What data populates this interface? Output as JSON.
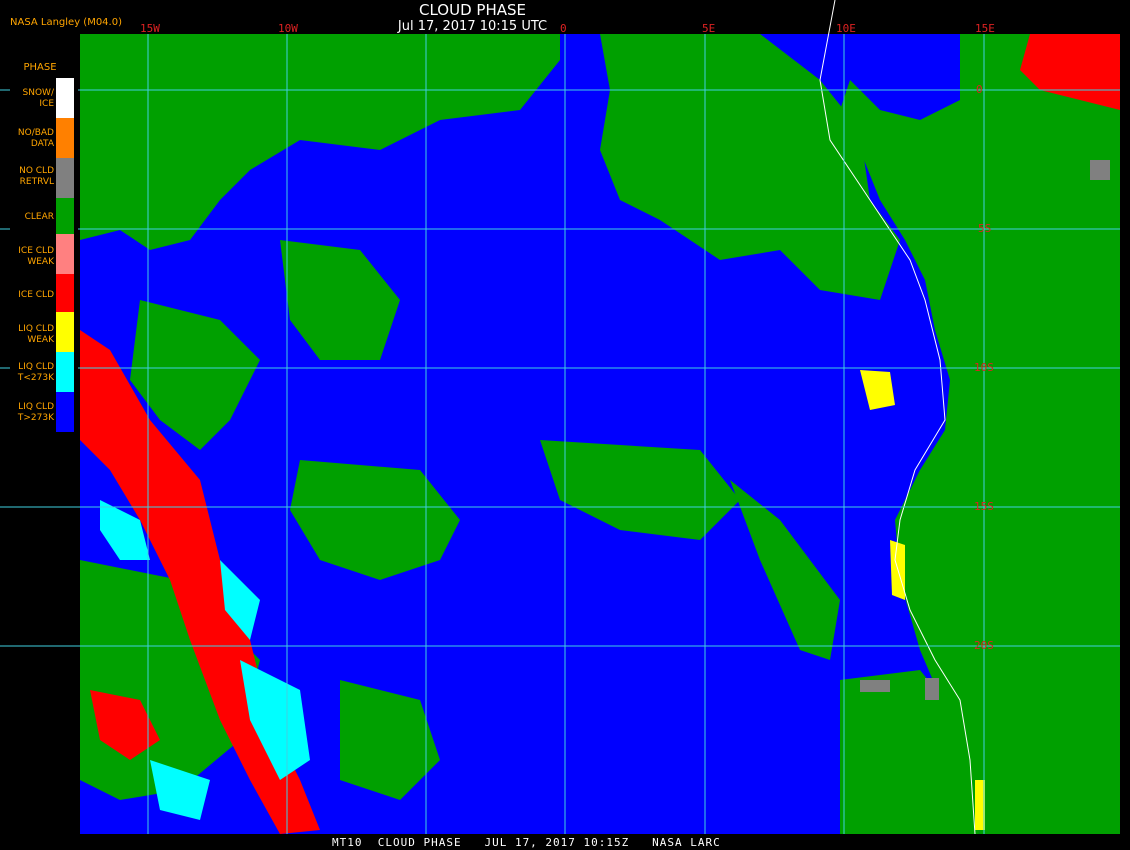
{
  "header": {
    "title": "CLOUD PHASE",
    "date": "Jul 17, 2017 10:15 UTC",
    "credit": "NASA Langley (M04.0)"
  },
  "legend": {
    "title": "PHASE",
    "items": [
      {
        "label": "SNOW/\nICE",
        "color": "#ffffff"
      },
      {
        "label": "NO/BAD\nDATA",
        "color": "#ff8000"
      },
      {
        "label": "NO CLD\nRETRVL",
        "color": "#808080"
      },
      {
        "label": "CLEAR",
        "color": "#00a000"
      },
      {
        "label": "ICE CLD\nWEAK",
        "color": "#ff8080"
      },
      {
        "label": "ICE CLD",
        "color": "#ff0000"
      },
      {
        "label": "LIQ CLD\nWEAK",
        "color": "#ffff00"
      },
      {
        "label": "LIQ CLD\nT<273K",
        "color": "#00ffff"
      },
      {
        "label": "LIQ CLD\nT>273K",
        "color": "#0000ff"
      }
    ]
  },
  "grid": {
    "lon_labels": [
      "15W",
      "10W",
      "0",
      "5E",
      "10E",
      "15E"
    ],
    "lat_labels": [
      "0",
      "5S",
      "10S",
      "15S",
      "20S"
    ],
    "line_color": "#40d0e0",
    "label_color": "#d22020"
  },
  "footer": {
    "text": "MT10  CLOUD PHASE   JUL 17, 2017 10:15Z   NASA LARC"
  }
}
